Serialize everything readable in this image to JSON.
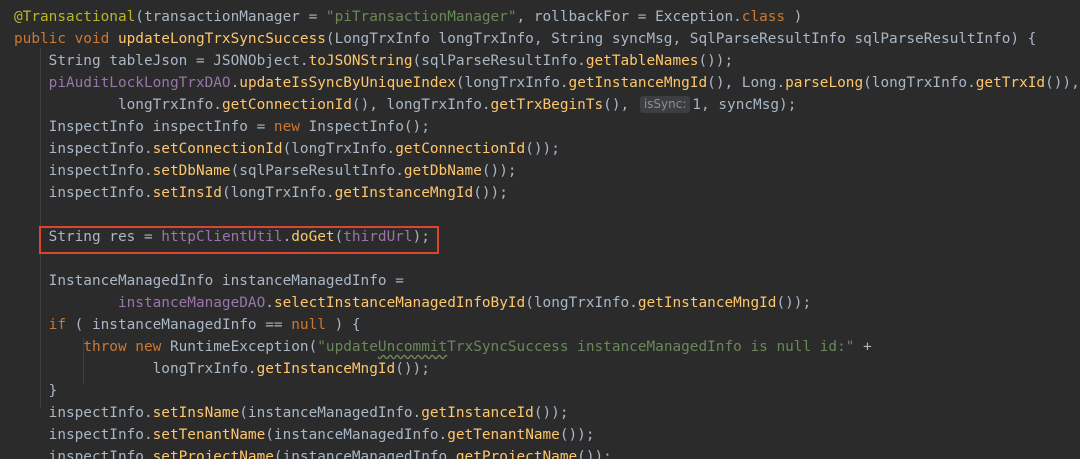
{
  "editor": {
    "lines": [
      {
        "segments": [
          {
            "t": "@Transactional",
            "c": "ann"
          },
          {
            "t": "(transactionManager = ",
            "c": "plain"
          },
          {
            "t": "\"piTransactionManager\"",
            "c": "str"
          },
          {
            "t": ", rollbackFor = Exception.",
            "c": "plain"
          },
          {
            "t": "class",
            "c": "kw"
          },
          {
            "t": " )",
            "c": "plain"
          }
        ]
      },
      {
        "segments": [
          {
            "t": "public void ",
            "c": "kw"
          },
          {
            "t": "updateLongTrxSyncSuccess",
            "c": "fn"
          },
          {
            "t": "(LongTrxInfo longTrxInfo, String syncMsg, SqlParseResultInfo sqlParseResultInfo) {",
            "c": "plain"
          }
        ]
      },
      {
        "segments": [
          {
            "t": "    String tableJson = JSONObject.",
            "c": "plain"
          },
          {
            "t": "toJSONString",
            "c": "fn"
          },
          {
            "t": "(sqlParseResultInfo.",
            "c": "plain"
          },
          {
            "t": "getTableNames",
            "c": "fn"
          },
          {
            "t": "());",
            "c": "plain"
          }
        ]
      },
      {
        "segments": [
          {
            "t": "    ",
            "c": "plain"
          },
          {
            "t": "piAuditLockLongTrxDAO",
            "c": "fld"
          },
          {
            "t": ".",
            "c": "plain"
          },
          {
            "t": "updateIsSyncByUniqueIndex",
            "c": "fn"
          },
          {
            "t": "(longTrxInfo.",
            "c": "plain"
          },
          {
            "t": "getInstanceMngId",
            "c": "fn"
          },
          {
            "t": "(), Long.",
            "c": "plain"
          },
          {
            "t": "parseLong",
            "c": "fn"
          },
          {
            "t": "(longTrxInfo.",
            "c": "plain"
          },
          {
            "t": "getTrxId",
            "c": "fn"
          },
          {
            "t": "()),",
            "c": "plain"
          }
        ]
      },
      {
        "segments": [
          {
            "t": "            longTrxInfo.",
            "c": "plain"
          },
          {
            "t": "getConnectionId",
            "c": "fn"
          },
          {
            "t": "(), longTrxInfo.",
            "c": "plain"
          },
          {
            "t": "getTrxBeginTs",
            "c": "fn"
          },
          {
            "t": "(), ",
            "c": "plain"
          },
          {
            "t": "isSync:",
            "c": "hint"
          },
          {
            "t": "1, syncMsg);",
            "c": "plain"
          }
        ]
      },
      {
        "segments": [
          {
            "t": "    InspectInfo inspectInfo = ",
            "c": "plain"
          },
          {
            "t": "new ",
            "c": "kw"
          },
          {
            "t": "InspectInfo();",
            "c": "plain"
          }
        ]
      },
      {
        "segments": [
          {
            "t": "    inspectInfo.",
            "c": "plain"
          },
          {
            "t": "setConnectionId",
            "c": "fn"
          },
          {
            "t": "(longTrxInfo.",
            "c": "plain"
          },
          {
            "t": "getConnectionId",
            "c": "fn"
          },
          {
            "t": "());",
            "c": "plain"
          }
        ]
      },
      {
        "segments": [
          {
            "t": "    inspectInfo.",
            "c": "plain"
          },
          {
            "t": "setDbName",
            "c": "fn"
          },
          {
            "t": "(sqlParseResultInfo.",
            "c": "plain"
          },
          {
            "t": "getDbName",
            "c": "fn"
          },
          {
            "t": "());",
            "c": "plain"
          }
        ]
      },
      {
        "segments": [
          {
            "t": "    inspectInfo.",
            "c": "plain"
          },
          {
            "t": "setInsId",
            "c": "fn"
          },
          {
            "t": "(longTrxInfo.",
            "c": "plain"
          },
          {
            "t": "getInstanceMngId",
            "c": "fn"
          },
          {
            "t": "());",
            "c": "plain"
          }
        ]
      },
      {
        "segments": [
          {
            "t": "",
            "c": "plain"
          }
        ]
      },
      {
        "segments": [
          {
            "t": "    String res = ",
            "c": "plain"
          },
          {
            "t": "httpClientUtil",
            "c": "fld"
          },
          {
            "t": ".",
            "c": "plain"
          },
          {
            "t": "doGet",
            "c": "fn"
          },
          {
            "t": "(",
            "c": "plain"
          },
          {
            "t": "thirdUrl",
            "c": "fld"
          },
          {
            "t": ");",
            "c": "plain"
          }
        ]
      },
      {
        "segments": [
          {
            "t": "",
            "c": "plain"
          }
        ]
      },
      {
        "segments": [
          {
            "t": "    InstanceManagedInfo instanceManagedInfo =",
            "c": "plain"
          }
        ]
      },
      {
        "segments": [
          {
            "t": "            ",
            "c": "plain"
          },
          {
            "t": "instanceManageDAO",
            "c": "fld"
          },
          {
            "t": ".",
            "c": "plain"
          },
          {
            "t": "selectInstanceManagedInfoById",
            "c": "fn"
          },
          {
            "t": "(longTrxInfo.",
            "c": "plain"
          },
          {
            "t": "getInstanceMngId",
            "c": "fn"
          },
          {
            "t": "());",
            "c": "plain"
          }
        ]
      },
      {
        "segments": [
          {
            "t": "    ",
            "c": "plain"
          },
          {
            "t": "if ",
            "c": "kw"
          },
          {
            "t": "( instanceManagedInfo == ",
            "c": "plain"
          },
          {
            "t": "null ",
            "c": "kw"
          },
          {
            "t": ") {",
            "c": "plain"
          }
        ]
      },
      {
        "segments": [
          {
            "t": "        ",
            "c": "plain"
          },
          {
            "t": "throw new ",
            "c": "kw"
          },
          {
            "t": "RuntimeException(",
            "c": "plain"
          },
          {
            "t": "\"update",
            "c": "str"
          },
          {
            "t": "Uncommit",
            "c": "str wavy"
          },
          {
            "t": "TrxSyncSuccess instanceManagedInfo is null id:\"",
            "c": "str"
          },
          {
            "t": " +",
            "c": "plain"
          }
        ]
      },
      {
        "segments": [
          {
            "t": "                longTrxInfo.",
            "c": "plain"
          },
          {
            "t": "getInstanceMngId",
            "c": "fn"
          },
          {
            "t": "());",
            "c": "plain"
          }
        ]
      },
      {
        "segments": [
          {
            "t": "    }",
            "c": "plain"
          }
        ]
      },
      {
        "segments": [
          {
            "t": "    inspectInfo.",
            "c": "plain"
          },
          {
            "t": "setInsName",
            "c": "fn"
          },
          {
            "t": "(instanceManagedInfo.",
            "c": "plain"
          },
          {
            "t": "getInstanceId",
            "c": "fn"
          },
          {
            "t": "());",
            "c": "plain"
          }
        ]
      },
      {
        "segments": [
          {
            "t": "    inspectInfo.",
            "c": "plain"
          },
          {
            "t": "setTenantName",
            "c": "fn"
          },
          {
            "t": "(instanceManagedInfo.",
            "c": "plain"
          },
          {
            "t": "getTenantName",
            "c": "fn"
          },
          {
            "t": "());",
            "c": "plain"
          }
        ]
      },
      {
        "segments": [
          {
            "t": "    inspectInfo.",
            "c": "plain"
          },
          {
            "t": "setProjectName",
            "c": "fn"
          },
          {
            "t": "(instanceManagedInfo.",
            "c": "plain"
          },
          {
            "t": "getProjectName",
            "c": "fn"
          },
          {
            "t": "());",
            "c": "plain"
          }
        ]
      }
    ],
    "highlighted_line": 10
  },
  "colors": {
    "background": "#2b2b2b",
    "keyword": "#cc7832",
    "string": "#6a8759",
    "field": "#9876aa",
    "method": "#ffc66d",
    "annotation": "#bbb529",
    "text": "#a9b7c6",
    "highlight_box": "#d9452e"
  }
}
